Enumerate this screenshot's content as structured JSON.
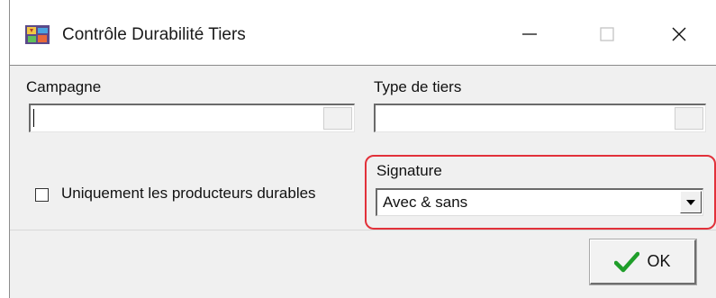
{
  "window": {
    "title": "Contrôle Durabilité Tiers",
    "app_icon": "app-icon",
    "controls": [
      "minimize-icon",
      "maximize-icon",
      "close-icon"
    ]
  },
  "form": {
    "campagne": {
      "label": "Campagne",
      "value": ""
    },
    "type_tiers": {
      "label": "Type de tiers",
      "value": ""
    },
    "producteurs_checkbox": {
      "label": "Uniquement les producteurs durables",
      "checked": false
    },
    "signature": {
      "label": "Signature",
      "selected": "Avec & sans"
    }
  },
  "actions": {
    "ok_label": "OK",
    "ok_icon": "checkmark-icon"
  },
  "colors": {
    "highlight": "#e2313a",
    "checkmark": "#1f9e2a",
    "window_bg": "#f0f0f0"
  }
}
